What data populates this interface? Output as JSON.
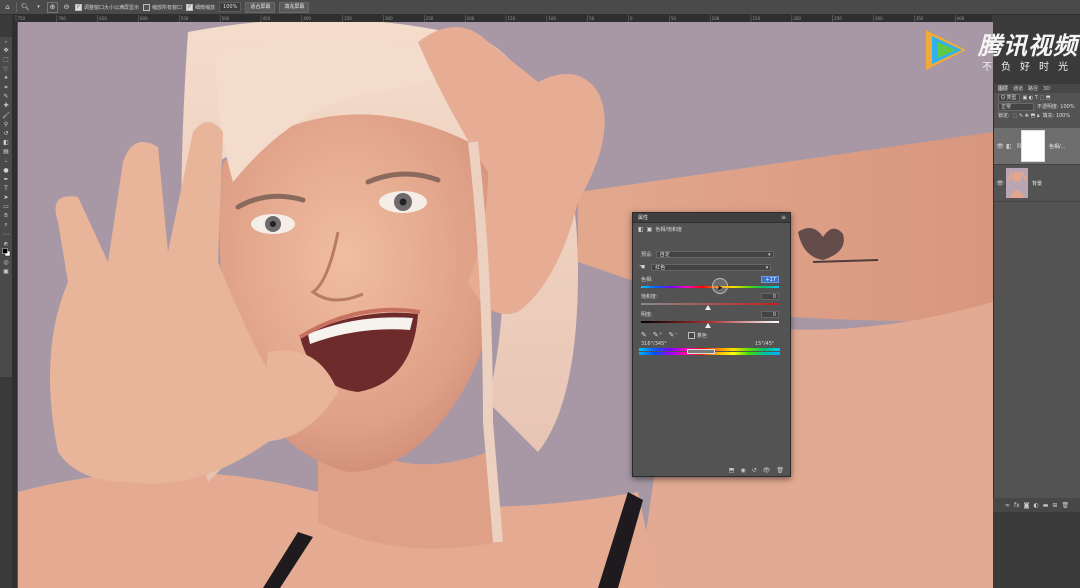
{
  "options_bar": {
    "checkbox_resize_windows": "调整窗口大小以满屏显示",
    "checkbox_zoom_all": "缩放所有窗口",
    "checkbox_scrubby_zoom": "细微缩放",
    "zoom_value": "100%",
    "fit_screen_button": "适合屏幕",
    "fill_screen_button": "填充屏幕"
  },
  "watermark": {
    "main": "腾讯视频",
    "sub": "不负好时光"
  },
  "properties": {
    "title": "属性",
    "subtitle": "色相/饱和度",
    "preset_label": "预设:",
    "preset_value": "自定",
    "channel_value": "红色",
    "hue_label": "色相:",
    "hue_value": "+17",
    "saturation_label": "饱和度:",
    "saturation_value": "0",
    "lightness_label": "明度:",
    "lightness_value": "0",
    "colorize_label": "着色",
    "range_left": "316°/345°",
    "range_right": "15°/45°"
  },
  "layers": {
    "tabs": [
      "图层",
      "通道",
      "路径",
      "3D"
    ],
    "filter_label": "Q 类型",
    "blend_mode": "正常",
    "opacity_label": "不透明度: 100%",
    "lock_label": "锁定:",
    "fill_label": "填充: 100%",
    "items": [
      {
        "name": "色相/...",
        "selected": true
      },
      {
        "name": "背景",
        "selected": false
      }
    ]
  },
  "ruler": {
    "ticks": [
      "750",
      "700",
      "650",
      "600",
      "550",
      "500",
      "450",
      "400",
      "350",
      "300",
      "250",
      "200",
      "150",
      "100",
      "50",
      "0",
      "50",
      "100",
      "150",
      "200",
      "250",
      "300",
      "350",
      "400"
    ]
  }
}
